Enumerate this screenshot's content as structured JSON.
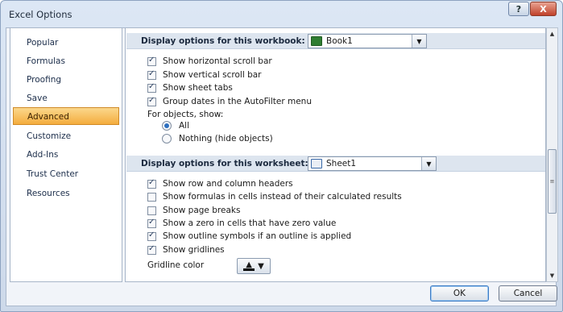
{
  "window": {
    "title": "Excel Options",
    "help_label": "?",
    "close_label": "X"
  },
  "nav": {
    "items": [
      {
        "label": "Popular"
      },
      {
        "label": "Formulas"
      },
      {
        "label": "Proofing"
      },
      {
        "label": "Save"
      },
      {
        "label": "Advanced",
        "selected": true
      },
      {
        "label": "Customize"
      },
      {
        "label": "Add-Ins"
      },
      {
        "label": "Trust Center"
      },
      {
        "label": "Resources"
      }
    ]
  },
  "workbook_section": {
    "label": "Display options for this workbook:",
    "selected_workbook": "Book1",
    "icon": "excel-workbook-icon",
    "options": [
      {
        "label": "Show horizontal scroll bar",
        "checked": true
      },
      {
        "label": "Show vertical scroll bar",
        "checked": true
      },
      {
        "label": "Show sheet tabs",
        "checked": true
      },
      {
        "label": "Group dates in the AutoFilter menu",
        "checked": true
      }
    ],
    "objects_label": "For objects, show:",
    "objects_options": [
      {
        "label": "All",
        "selected": true
      },
      {
        "label": "Nothing (hide objects)",
        "selected": false
      }
    ]
  },
  "worksheet_section": {
    "label": "Display options for this worksheet:",
    "selected_sheet": "Sheet1",
    "icon": "worksheet-icon",
    "options": [
      {
        "label": "Show row and column headers",
        "checked": true
      },
      {
        "label": "Show formulas in cells instead of their calculated results",
        "checked": false
      },
      {
        "label": "Show page breaks",
        "checked": false
      },
      {
        "label": "Show a zero in cells that have zero value",
        "checked": true
      },
      {
        "label": "Show outline symbols if an outline is applied",
        "checked": true
      },
      {
        "label": "Show gridlines",
        "checked": true
      }
    ],
    "gridline_color_label": "Gridline color",
    "gridline_color": "#000000"
  },
  "buttons": {
    "ok": "OK",
    "cancel": "Cancel"
  },
  "colors": {
    "accent": "#f4ad3e",
    "section_header": "#dde5ef",
    "radio_dot": "#2d6fbf"
  }
}
